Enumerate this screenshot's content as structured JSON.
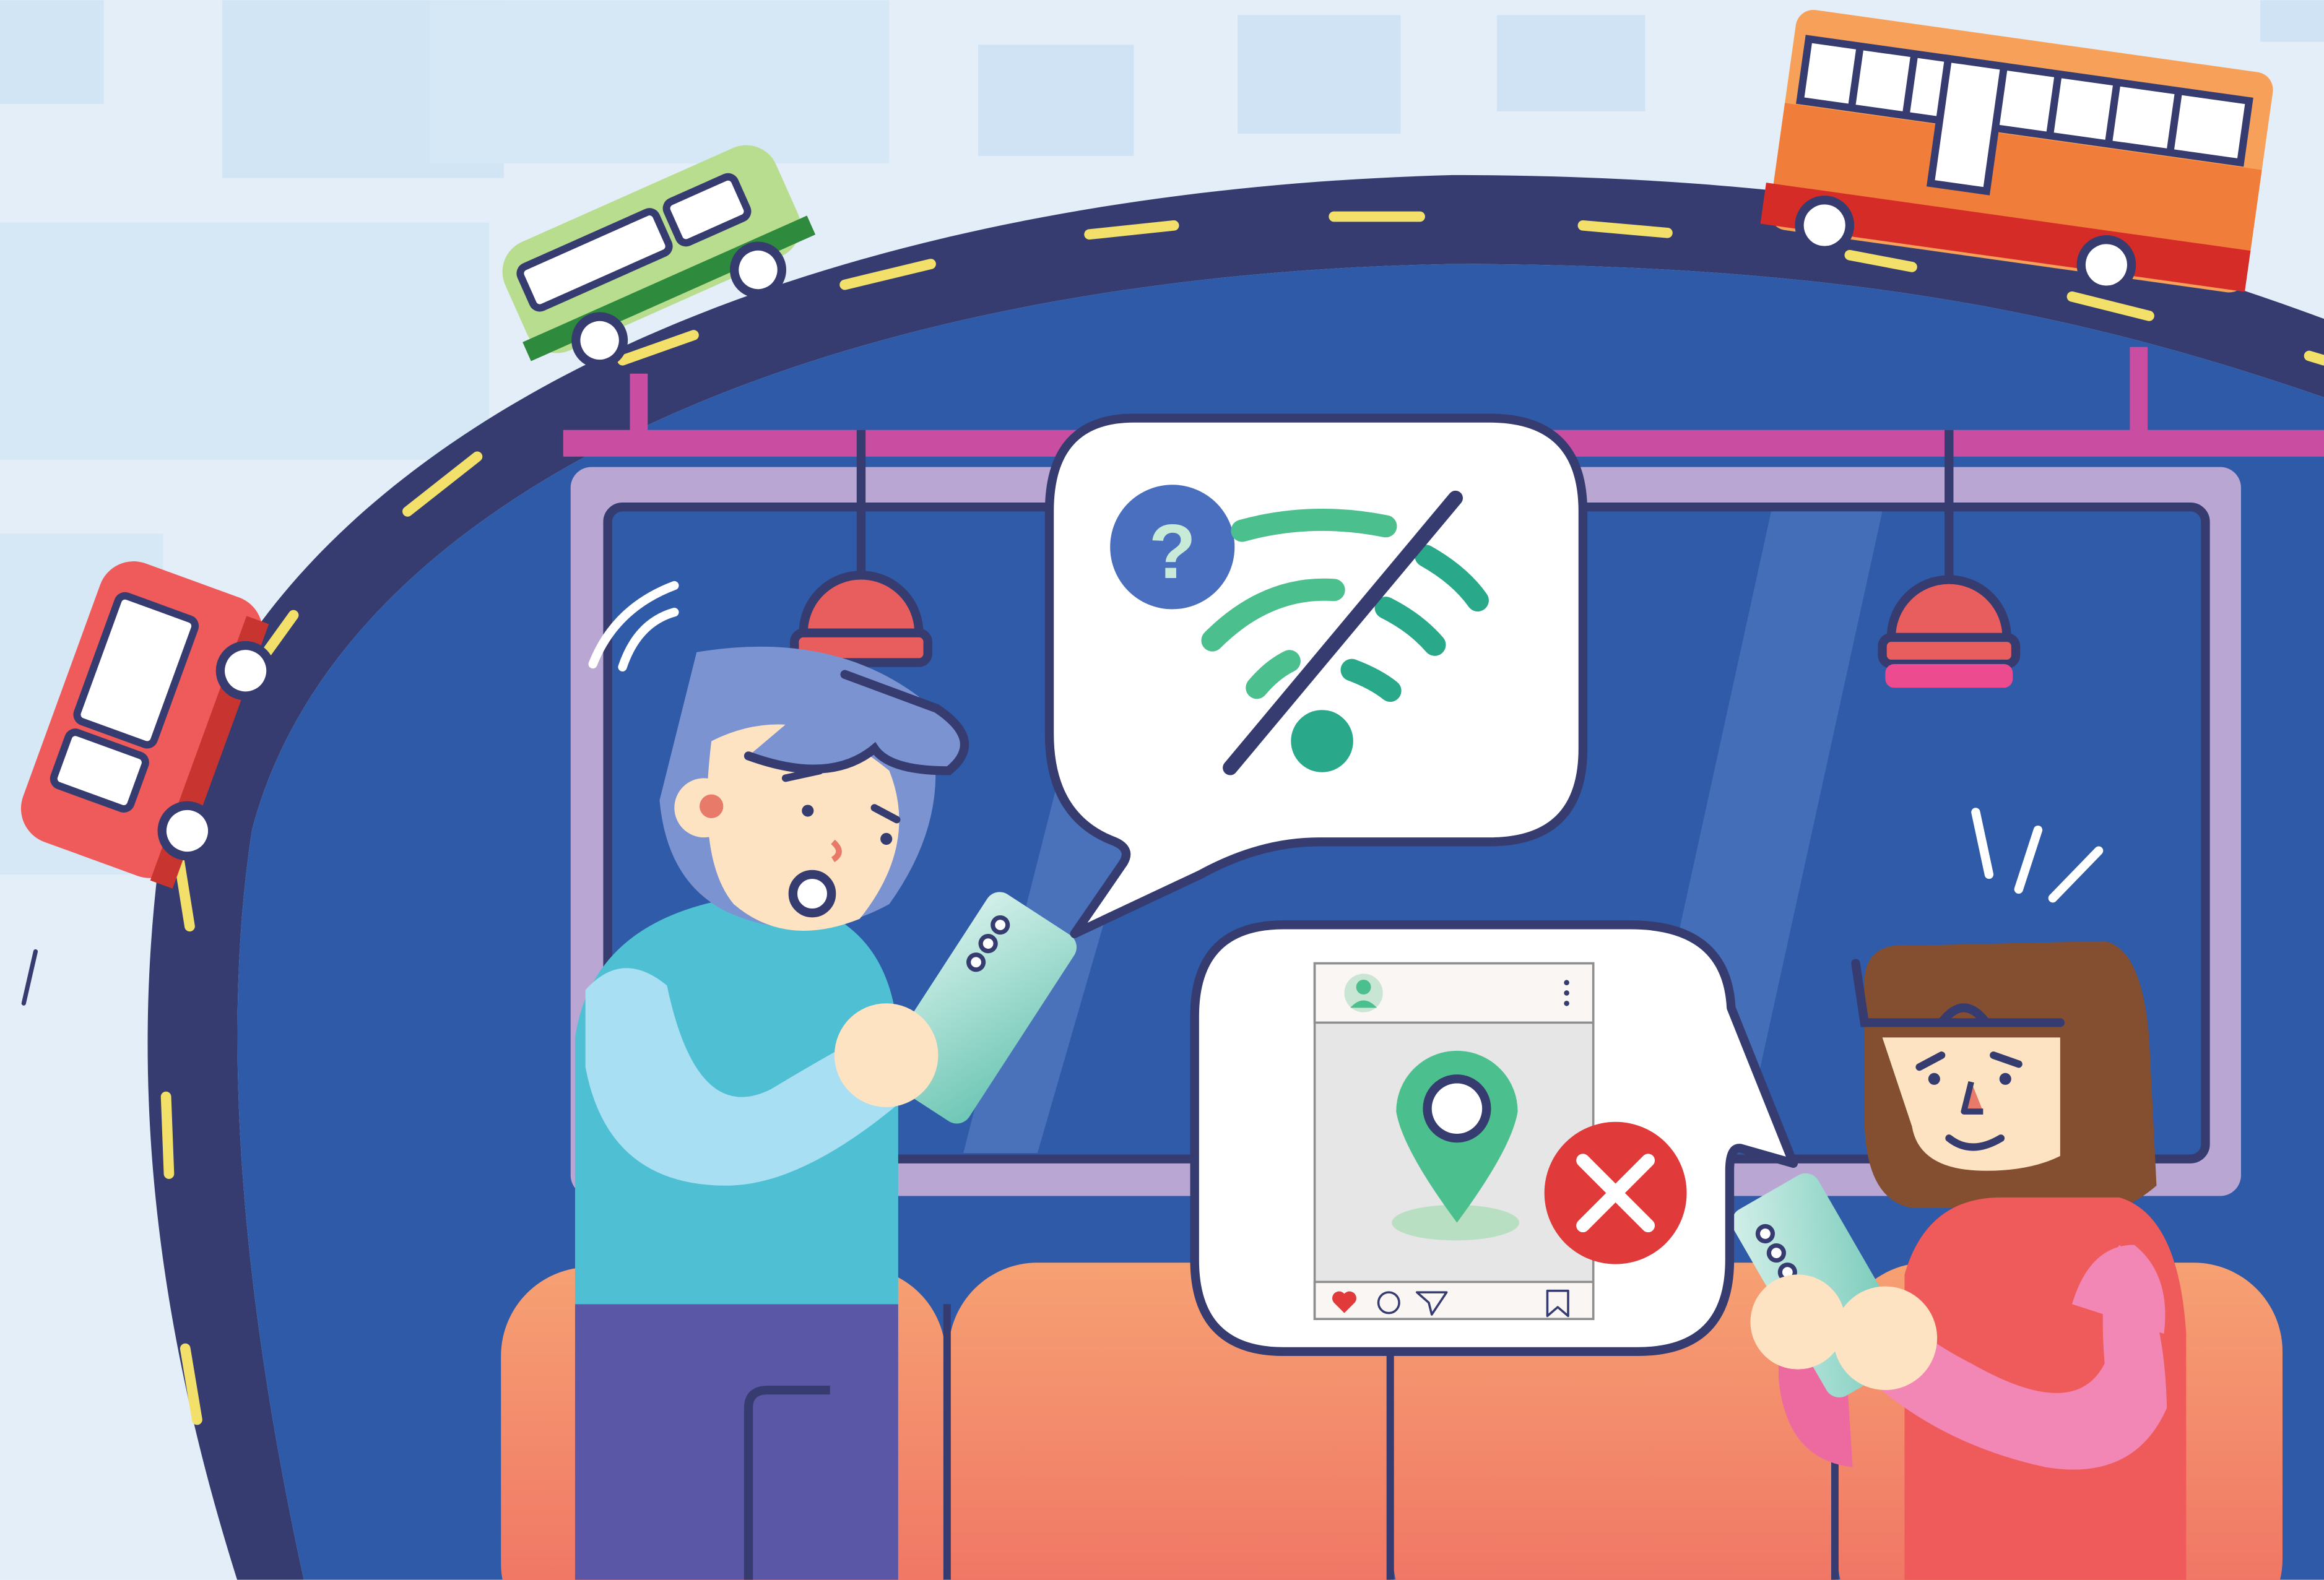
{
  "illustration": {
    "colors": {
      "sky": "#e3eef8",
      "city": "#d2e5f5",
      "outline": "#363c70",
      "train_interior": "#2e5aa8",
      "rail_pink": "#c94da0",
      "window_frame": "#b9a6d2",
      "seat": "#f28a66",
      "road_dash": "#f2e06a",
      "wifi_green": "#4cbf8e",
      "wifi_teal": "#2aa88a",
      "error_red": "#e03a3a"
    },
    "icons": {
      "help": "question-mark-icon",
      "wifi": "wifi-off-icon",
      "location": "map-pin-icon",
      "error": "close-x-icon",
      "like": "heart-icon",
      "comment": "comment-icon",
      "share": "send-icon",
      "save": "bookmark-icon",
      "menu": "more-vertical-icon",
      "profile": "user-avatar-icon"
    },
    "question_mark": "?"
  }
}
